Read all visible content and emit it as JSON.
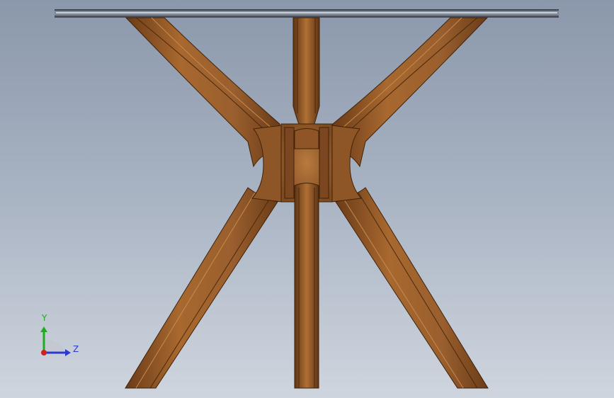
{
  "view": {
    "background_top": "#8b98ab",
    "background_bottom": "#cfd5de"
  },
  "model": {
    "wood_color": "#9a5f2e",
    "wood_dark": "#5e3415",
    "wood_light": "#b7773f",
    "glass_color": "#7f8794"
  },
  "triad": {
    "y_label": "Y",
    "z_label": "Z",
    "y_color": "#22aa22",
    "z_color": "#2a3ad0",
    "x_color": "#d02020"
  }
}
